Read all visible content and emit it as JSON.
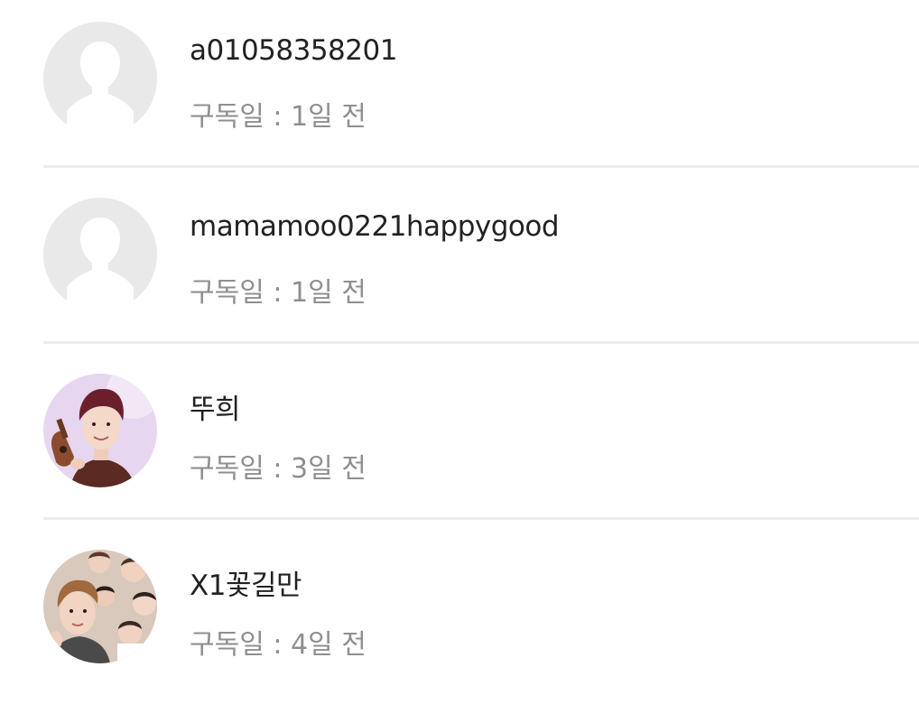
{
  "subscribers": [
    {
      "name": "a01058358201",
      "meta": "구독일 : 1일 전",
      "avatar_icon": "default-avatar-icon"
    },
    {
      "name": "mamamoo0221happygood",
      "meta": "구독일 : 1일 전",
      "avatar_icon": "default-avatar-icon"
    },
    {
      "name": "뚜희",
      "meta": "구독일 : 3일 전",
      "avatar_icon": "profile-photo"
    },
    {
      "name": "X1꽃길만",
      "meta": "구독일 : 4일 전",
      "avatar_icon": "profile-photo"
    }
  ],
  "colors": {
    "name_text": "#222222",
    "meta_text": "#8f8f8f",
    "divider": "#ececec",
    "default_avatar_bg": "#e9e9e9",
    "default_avatar_silhouette": "#ffffff"
  }
}
